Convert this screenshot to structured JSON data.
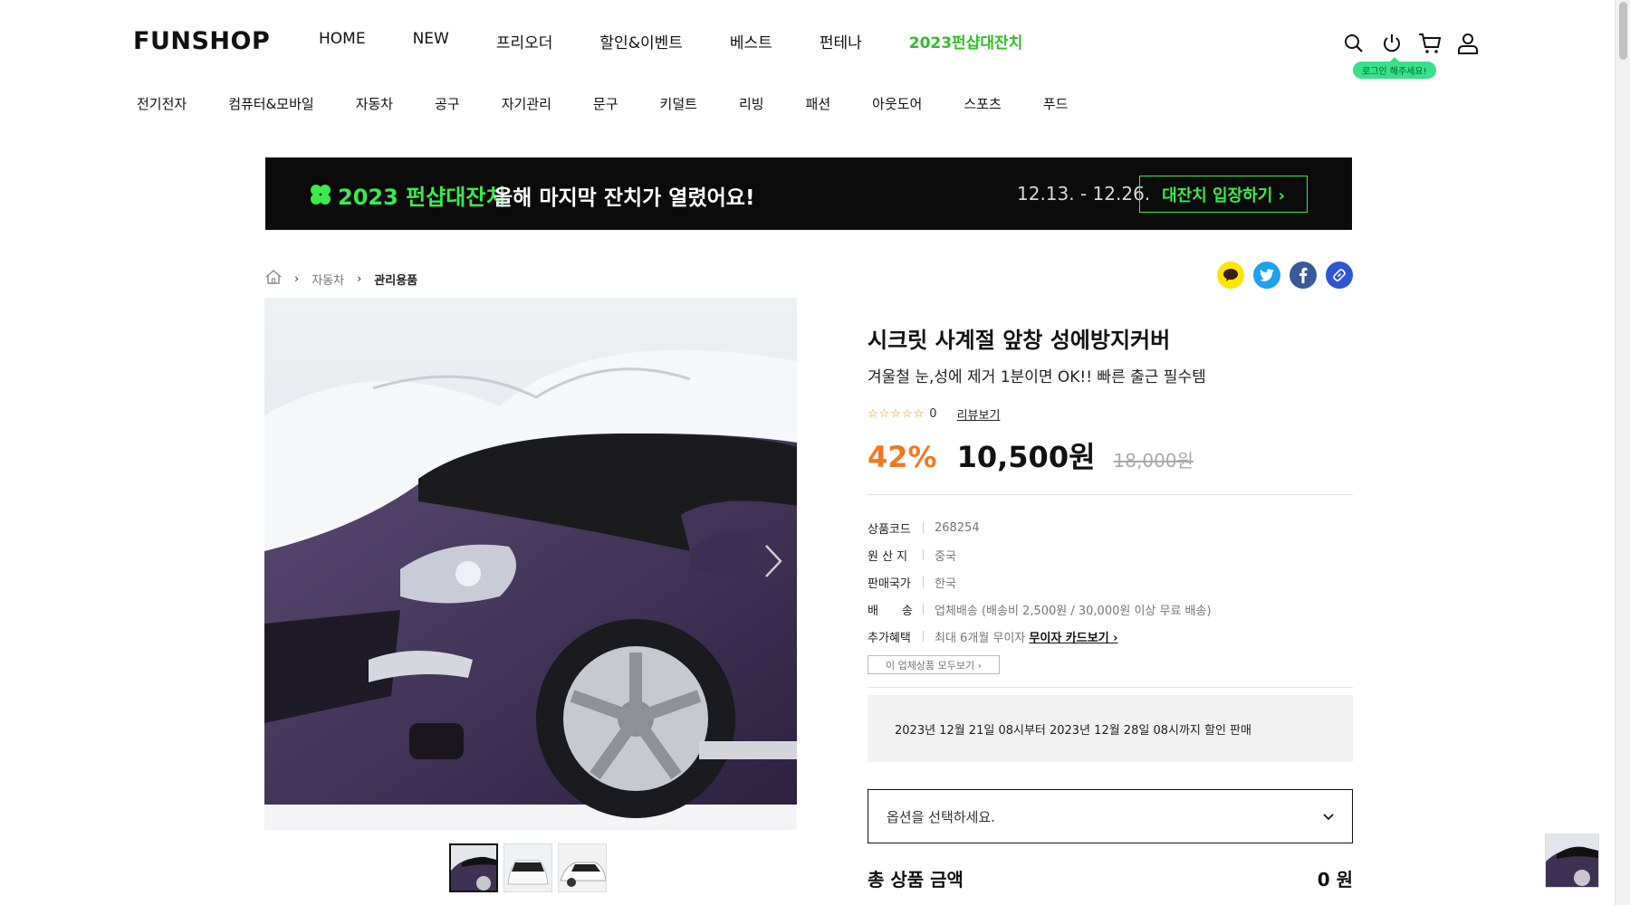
{
  "header": {
    "logo": "FUNSHOP",
    "nav": [
      "HOME",
      "NEW",
      "프리오더",
      "할인&이벤트",
      "베스트",
      "펀테나",
      "2023펀샵대잔치"
    ],
    "login_tooltip": "로그인 해주세요!",
    "icons": [
      "search-icon",
      "power-icon",
      "cart-icon",
      "user-icon"
    ]
  },
  "categories": [
    "전기전자",
    "컴퓨터&모바일",
    "자동차",
    "공구",
    "자기관리",
    "문구",
    "키덜트",
    "리빙",
    "패션",
    "아웃도어",
    "스포츠",
    "푸드"
  ],
  "banner": {
    "event_name": "2023 펀샵대잔치",
    "headline": "올해 마지막 잔치가 열렸어요!",
    "period": "12.13. - 12.26.",
    "button": "대잔치 입장하기 ›",
    "accent": "#3bea4e"
  },
  "breadcrumb": [
    "자동차",
    "관리용품"
  ],
  "share": [
    "kakao-icon",
    "twitter-icon",
    "facebook-icon",
    "link-icon"
  ],
  "product": {
    "title": "시크릿 사계절 앞창 성에방지커버",
    "subtitle": "겨울철 눈,성에 제거 1분이면 OK!! 빠른 출근 필수템",
    "stars": "☆☆☆☆☆",
    "rating_count": "0",
    "review_link": "리뷰보기",
    "discount_rate": "42%",
    "sale_price": "10,500원",
    "original_price": "18,000원",
    "specs": [
      {
        "label": "상품코드",
        "value": "268254"
      },
      {
        "label": "원 산 지",
        "value": "중국"
      },
      {
        "label": "판매국가",
        "value": "한국"
      },
      {
        "label": "배　　송",
        "value": "업체배송 (배송비 2,500원 / 30,000원 이상 무료 배송)"
      },
      {
        "label": "추가혜택",
        "value": "최대 6개월 무이자",
        "link": "무이자 카드보기 ›"
      }
    ],
    "all_items_button": "이 업체상품 모두보기 ›",
    "sale_notice": "2023년 12월 21일 08시부터 2023년 12월 28일 08시까지 할인 판매",
    "option_placeholder": "옵션을 선택하세요.",
    "total_label": "총 상품 금액",
    "total_value": "0 원",
    "accent": "#f07a22"
  }
}
